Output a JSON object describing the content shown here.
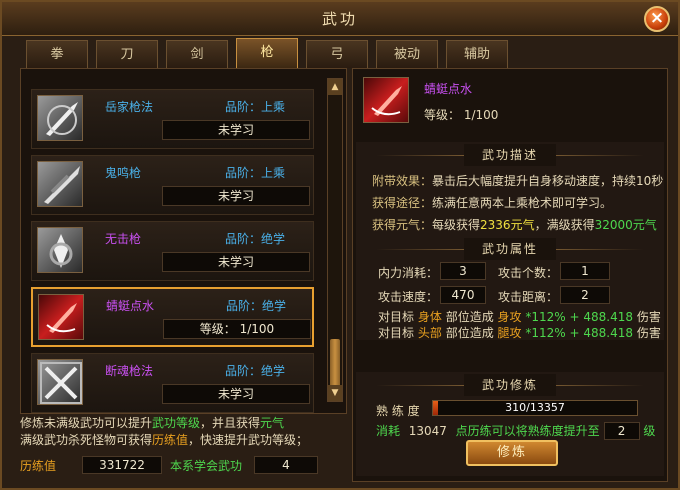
{
  "window": {
    "title": "武功"
  },
  "tabs": [
    {
      "label": "拳"
    },
    {
      "label": "刀"
    },
    {
      "label": "剑"
    },
    {
      "label": "枪",
      "active": true
    },
    {
      "label": "弓"
    },
    {
      "label": "被动"
    },
    {
      "label": "辅助"
    }
  ],
  "skills": [
    {
      "name": "岳家枪法",
      "name_color": "#4ab0e8",
      "grade": "品阶：上乘",
      "status": "未学习"
    },
    {
      "name": "鬼鸣枪",
      "name_color": "#4ab0e8",
      "grade": "品阶：上乘",
      "status": "未学习"
    },
    {
      "name": "无击枪",
      "name_color": "#c850f0",
      "grade": "品阶：绝学",
      "status": "未学习"
    },
    {
      "name": "蜻蜓点水",
      "name_color": "#c850f0",
      "grade": "品阶：绝学",
      "status": "等级：   1/100",
      "selected": true
    },
    {
      "name": "断魂枪法",
      "name_color": "#c850f0",
      "grade": "品阶：绝学",
      "status": "未学习"
    }
  ],
  "info": {
    "line1_a": "修炼未满级武功可以提升",
    "line1_b": "武功等级",
    "line1_c": "，并且获得",
    "line1_d": "元气",
    "line2_a": "满级武功杀死怪物可获得",
    "line2_b": "历练值",
    "line2_c": "，快速提升武功等级；",
    "exp_label": "历练值",
    "exp_value": "331722",
    "learned_label": "本系学会武功",
    "learned_value": "4"
  },
  "detail": {
    "name": "蜻蜓点水",
    "level": "等级：   1/100",
    "desc_title": "武功描述",
    "effect_label": "附带效果：",
    "effect_text": "暴击后大幅度提升自身移动速度，持续10秒",
    "obtain_label": "获得途径：",
    "obtain_text": "练满任意两本上乘枪术即可学习。",
    "qi_label": "获得元气：",
    "qi_a": "每级获得",
    "qi_b": "2336元气",
    "qi_c": "，满级获得",
    "qi_d": "32000元气",
    "attr_title": "武功属性",
    "cost_label": "内力消耗：",
    "cost_value": "3",
    "hits_label": "攻击个数：",
    "hits_value": "1",
    "speed_label": "攻击速度：",
    "speed_value": "470",
    "range_label": "攻击距离：",
    "range_value": "2",
    "bonus1": {
      "a": "对目标",
      "b": "身体",
      "c": "部位造成",
      "d": "身攻",
      "e": "*112%",
      "f": "+ 488.418",
      "g": "伤害"
    },
    "bonus2": {
      "a": "对目标",
      "b": "头部",
      "c": "部位造成",
      "d": "腿攻",
      "e": "*112%",
      "f": "+ 488.418",
      "g": "伤害"
    },
    "train_title": "武功修炼",
    "prof_label": "熟 练 度",
    "prof_text": "310/13357",
    "prof_fraction": 0.0232,
    "cost2_label": "消耗",
    "cost2_value": "13047",
    "cost2_text": "点历练可以将熟练度提升至",
    "cost2_level": "2",
    "cost2_unit": "级",
    "train_button": "修炼"
  }
}
